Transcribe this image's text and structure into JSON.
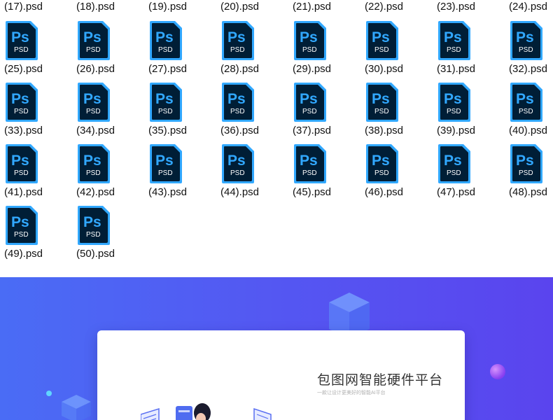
{
  "file_browser": {
    "top_row_labels": [
      "(17).psd",
      "(18).psd",
      "(19).psd",
      "(20).psd",
      "(21).psd",
      "(22).psd",
      "(23).psd",
      "(24).psd"
    ],
    "files": [
      "(25).psd",
      "(26).psd",
      "(27).psd",
      "(28).psd",
      "(29).psd",
      "(30).psd",
      "(31).psd",
      "(32).psd",
      "(33).psd",
      "(34).psd",
      "(35).psd",
      "(36).psd",
      "(37).psd",
      "(38).psd",
      "(39).psd",
      "(40).psd",
      "(41).psd",
      "(42).psd",
      "(43).psd",
      "(44).psd",
      "(45).psd",
      "(46).psd",
      "(47).psd",
      "(48).psd",
      "(49).psd",
      "(50).psd"
    ],
    "icon": {
      "name": "photoshop-file-icon",
      "glyph": "Ps",
      "sub": "PSD",
      "bg": "#001e36",
      "accent": "#31a8ff"
    }
  },
  "banner": {
    "title": "包图网智能硬件平台",
    "subtitle": "一款让设计更美好的智能AI平台",
    "colors": {
      "start": "#4a6cf5",
      "end": "#5a44ee",
      "card": "#ffffff"
    }
  }
}
